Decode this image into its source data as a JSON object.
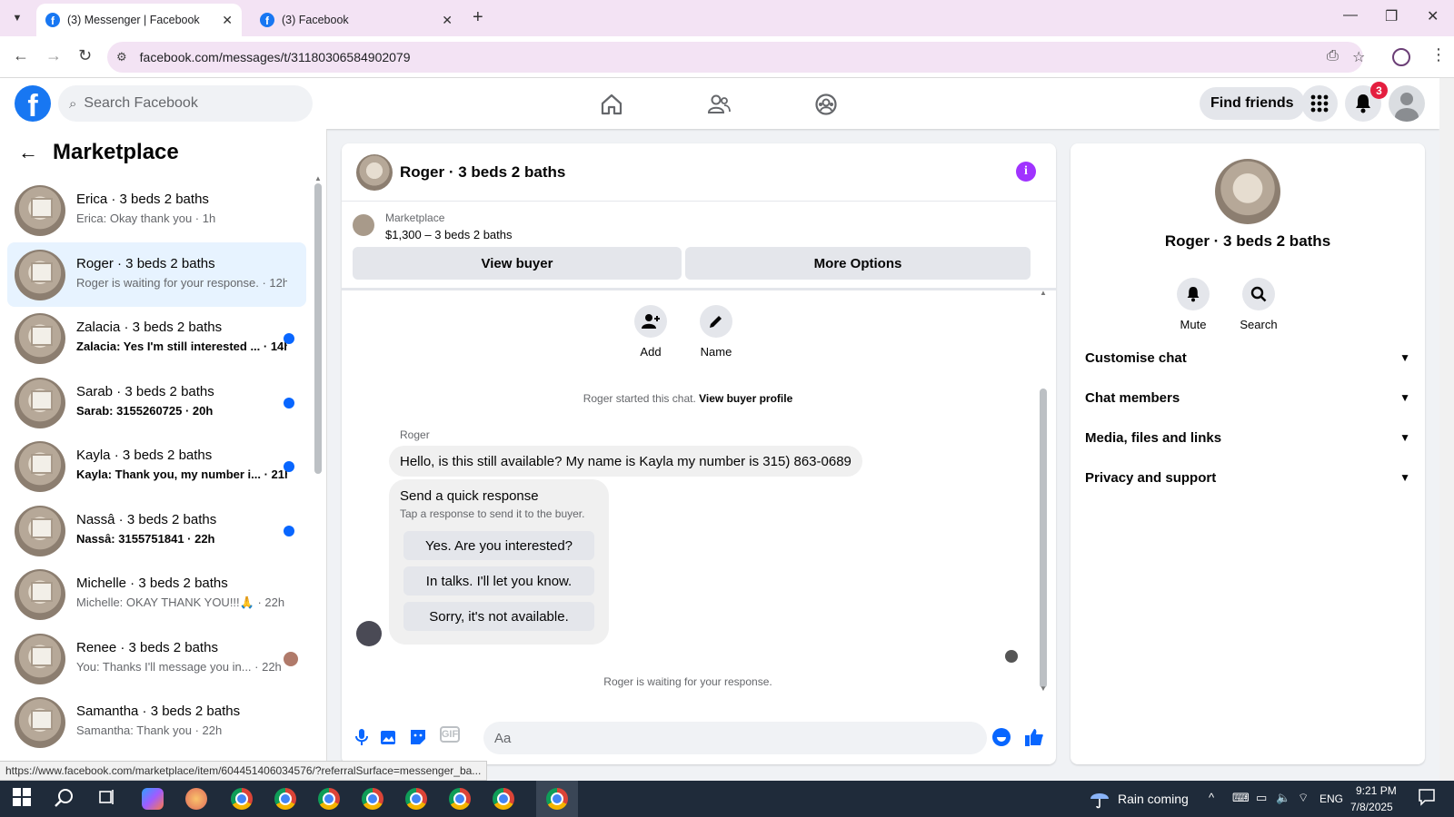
{
  "browser": {
    "tabs": [
      {
        "title": "(3) Messenger | Facebook",
        "active": true
      },
      {
        "title": "(3) Facebook",
        "active": false
      }
    ],
    "url": "facebook.com/messages/t/31180306584902079"
  },
  "fb_header": {
    "search_placeholder": "Search Facebook",
    "find_friends": "Find friends",
    "notification_count": "3"
  },
  "sidebar": {
    "title": "Marketplace",
    "conversations": [
      {
        "name": "Erica · 3 beds 2 baths",
        "preview": "Erica: Okay thank you · 1h",
        "unread": false,
        "active": false
      },
      {
        "name": "Roger · 3 beds 2 baths",
        "preview": "Roger is waiting for your response. · 12h",
        "unread": false,
        "active": true
      },
      {
        "name": "Zalacia · 3 beds 2 baths",
        "preview": "Zalacia: Yes I'm still interested ... · 14h",
        "unread": true,
        "active": false
      },
      {
        "name": "Sarab · 3 beds 2 baths",
        "preview": "Sarab: 3155260725 · 20h",
        "unread": true,
        "active": false
      },
      {
        "name": "Kayla · 3 beds 2 baths",
        "preview": "Kayla: Thank you, my number i... · 21h",
        "unread": true,
        "active": false
      },
      {
        "name": "Nassâ · 3 beds 2 baths",
        "preview": "Nassâ: 3155751841 · 22h",
        "unread": true,
        "active": false
      },
      {
        "name": "Michelle · 3 beds 2 baths",
        "preview": "Michelle: OKAY THANK YOU!!!🙏 · 22h",
        "unread": false,
        "active": false
      },
      {
        "name": "Renee · 3 beds 2 baths",
        "preview": "You: Thanks I'll message you in... · 22h",
        "unread": false,
        "active": false
      },
      {
        "name": "Samantha · 3 beds 2 baths",
        "preview": "Samantha: Thank you · 22h",
        "unread": false,
        "active": false
      }
    ]
  },
  "chat": {
    "title": "Roger · 3 beds 2 baths",
    "listing_source": "Marketplace",
    "listing_price": "$1,300 – 3 beds 2 baths",
    "view_buyer": "View buyer",
    "more_options": "More Options",
    "add_label": "Add",
    "name_label": "Name",
    "started_text": "Roger started this chat.",
    "view_buyer_profile": "View buyer profile",
    "sender": "Roger",
    "message": "Hello, is this still available? My name is Kayla my number is 315) 863-0689",
    "quick_title": "Send a quick response",
    "quick_subtitle": "Tap a response to send it to the buyer.",
    "quick_responses": [
      "Yes. Are you interested?",
      "In talks. I'll let you know.",
      "Sorry, it's not available."
    ],
    "waiting_text": "Roger is waiting for your response.",
    "composer_placeholder": "Aa"
  },
  "right_panel": {
    "name": "Roger · 3 beds 2 baths",
    "mute": "Mute",
    "search": "Search",
    "sections": [
      "Customise chat",
      "Chat members",
      "Media, files and links",
      "Privacy and support"
    ]
  },
  "status_url": "https://www.facebook.com/marketplace/item/604451406034576/?referralSurface=messenger_ba...",
  "taskbar": {
    "weather": "Rain coming",
    "lang": "ENG",
    "time": "9:21 PM",
    "date": "7/8/2025"
  },
  "colors": {
    "fb_blue": "#1877f2",
    "messenger_blue": "#0866ff",
    "info_purple": "#a033ff",
    "badge_red": "#e41e3f"
  }
}
